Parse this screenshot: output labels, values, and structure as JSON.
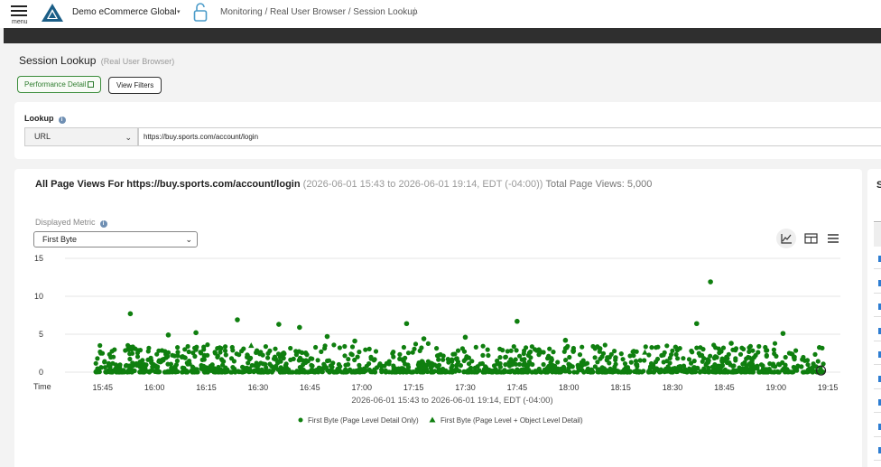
{
  "header": {
    "menu_label": "menu",
    "org_name": "Demo eCommerce Global",
    "breadcrumb": "Monitoring / Real User Browser / Session Lookup",
    "brand_color": "#1b5e87",
    "icons": [
      "menu-icon",
      "logo-icon",
      "org-dropdown-icon",
      "lock-icon",
      "pin-icon"
    ]
  },
  "page": {
    "title": "Session Lookup",
    "subtitle": "(Real User Browser)",
    "perf_button": "Performance Detail",
    "filters_button": "View Filters"
  },
  "lookup": {
    "label": "Lookup",
    "type_value": "URL",
    "url_value": "https://buy.sports.com/account/login"
  },
  "chart_panel": {
    "heading_main": "All Page Views For https://buy.sports.com/account/login",
    "heading_range": "(2026-06-01 15:43 to 2026-06-01 19:14, EDT (-04:00))",
    "heading_total": "Total Page Views: 5,000",
    "metric_label": "Displayed Metric",
    "metric_value": "First Byte",
    "view_icons": [
      "line-chart-icon",
      "table-icon",
      "list-icon"
    ]
  },
  "side_panel": {
    "letter": "S"
  },
  "chart_data": {
    "type": "scatter",
    "x_axis_label": "Time",
    "x_ticks": [
      "15:45",
      "16:00",
      "16:15",
      "16:30",
      "16:45",
      "17:00",
      "17:15",
      "17:30",
      "17:45",
      "18:00",
      "18:15",
      "18:30",
      "18:45",
      "19:00",
      "19:15"
    ],
    "x_range": [
      "15:43",
      "19:14"
    ],
    "x_title": "2026-06-01 15:43 to 2026-06-01 19:14, EDT (-04:00)",
    "y_ticks": [
      0,
      5,
      10,
      15
    ],
    "ylim": [
      0,
      15
    ],
    "grid": true,
    "color": "#0f7f0f",
    "legend_position": "bottom",
    "series": [
      {
        "name": "First Byte (Page Level Detail Only)",
        "marker": "circle",
        "note": "Dense cloud of ~5000 points mostly between 0 and 3; representative notable values listed",
        "points": [
          [
            "15:53",
            7.7
          ],
          [
            "16:04",
            4.9
          ],
          [
            "16:12",
            5.2
          ],
          [
            "16:24",
            6.9
          ],
          [
            "16:36",
            6.3
          ],
          [
            "16:42",
            5.9
          ],
          [
            "16:50",
            4.7
          ],
          [
            "16:58",
            4.1
          ],
          [
            "17:13",
            6.4
          ],
          [
            "17:18",
            4.4
          ],
          [
            "17:30",
            4.6
          ],
          [
            "17:45",
            6.7
          ],
          [
            "17:59",
            4.2
          ],
          [
            "18:09",
            3.1
          ],
          [
            "18:37",
            6.4
          ],
          [
            "18:41",
            11.9
          ],
          [
            "18:47",
            3.8
          ],
          [
            "19:02",
            5.1
          ],
          [
            "19:13",
            0.1
          ]
        ]
      },
      {
        "name": "First Byte (Page Level + Object Level Detail)",
        "marker": "triangle",
        "points": [
          [
            "16:28",
            3.5
          ],
          [
            "18:22",
            2.6
          ]
        ]
      }
    ]
  }
}
